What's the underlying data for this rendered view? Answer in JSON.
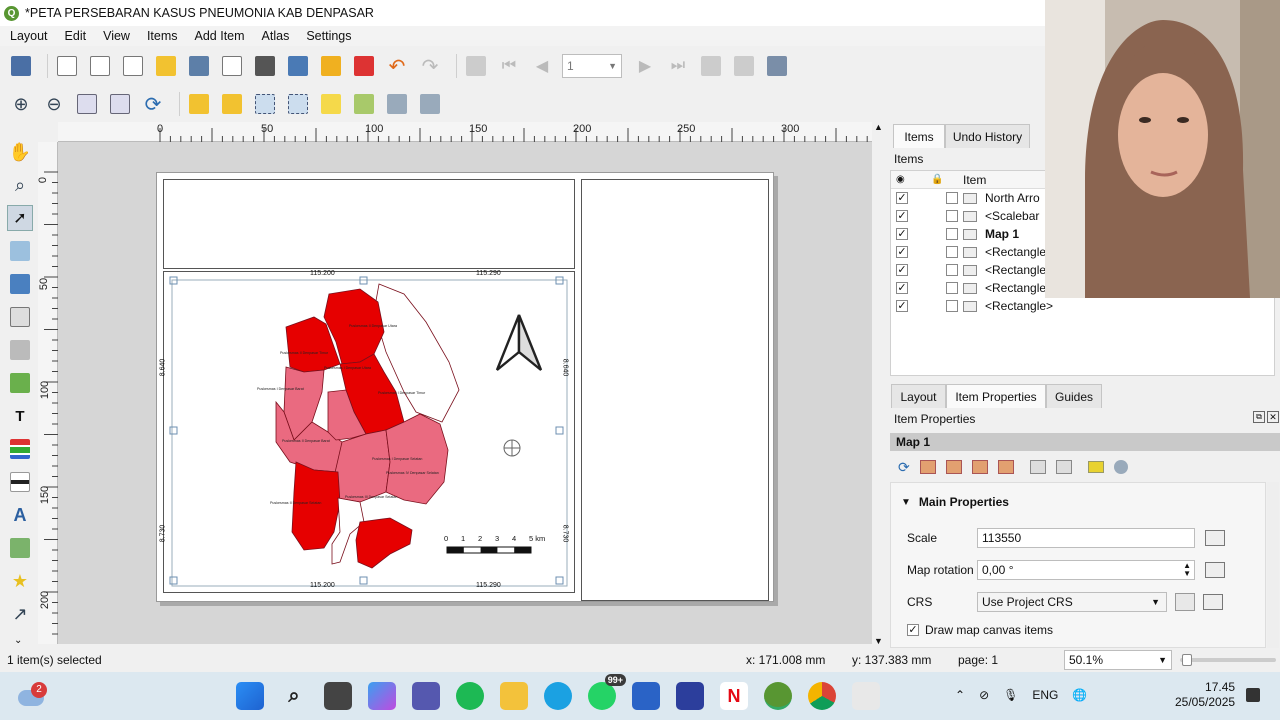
{
  "window": {
    "title": "*PETA PERSEBARAN KASUS PNEUMONIA KAB DENPASAR"
  },
  "menu": [
    "Layout",
    "Edit",
    "View",
    "Items",
    "Add Item",
    "Atlas",
    "Settings"
  ],
  "toolbar1": {
    "page_value": "1",
    "icons": [
      "save-layout-icon",
      "new-layout-icon",
      "duplicate-layout-icon",
      "layout-manager-icon",
      "open-template-icon",
      "save-template-icon",
      "page-setup-icon",
      "print-icon",
      "export-image-icon",
      "export-svg-icon",
      "export-pdf-icon",
      "undo-icon",
      "redo-icon",
      "atlas-settings-icon",
      "first-feature-icon",
      "prev-feature-icon",
      "next-feature-icon",
      "last-feature-icon",
      "atlas-print-icon",
      "atlas-export-icon",
      "atlas-preview-icon"
    ]
  },
  "toolbar2": {
    "icons": [
      "zoom-in-icon",
      "zoom-out-icon",
      "zoom-100-icon",
      "zoom-full-icon",
      "refresh-icon",
      "lock-items-icon",
      "unlock-items-icon",
      "select-all-icon",
      "deselect-icon",
      "raise-items-icon",
      "align-icon",
      "distribute-icon",
      "resize-icon"
    ]
  },
  "left_tools": [
    "pan-icon",
    "zoom-tool-icon",
    "select-move-icon",
    "move-content-icon",
    "edit-nodes-icon",
    "add-map-icon",
    "add-3d-map-icon",
    "add-picture-icon",
    "add-label-icon",
    "add-legend-icon",
    "add-scalebar-icon",
    "add-north-arrow-icon",
    "add-shape-icon",
    "add-marker-icon",
    "add-arrow-icon"
  ],
  "ruler": {
    "h_labels": [
      "0",
      "50",
      "100",
      "150",
      "200",
      "250",
      "300"
    ],
    "v_labels": [
      "0",
      "50",
      "100",
      "150",
      "200"
    ]
  },
  "map": {
    "grid_top": [
      "115.200",
      "115.290"
    ],
    "grid_bottom": [
      "115.200",
      "115.290"
    ],
    "grid_left": [
      "8.640",
      "8.730"
    ],
    "grid_right": [
      "8.640",
      "8.730"
    ],
    "scalebar_labels": [
      "0",
      "1",
      "2",
      "3",
      "4",
      "5 km"
    ],
    "region_labels": [
      "Puskesmas II Denpasar Utara",
      "Puskesmas II Denpasar Timur",
      "Puskesmas I Denpasar Utara",
      "Puskesmas I Denpasar Timur",
      "Puskesmas I Denpasar Barat",
      "Puskesmas II Denpasar Barat",
      "Puskesmas I Denpasar Selatan",
      "Puskesmas IV Denpasar Selatan",
      "Puskesmas III Denpasar Selatan",
      "Puskesmas II Denpasar Selatan"
    ],
    "colors": {
      "dark": "#e60000",
      "light": "#ea6a80",
      "white": "#ffffff"
    }
  },
  "status": {
    "selected": "1 item(s) selected",
    "x": "x: 171.008 mm",
    "y": "y: 137.383 mm",
    "page": "page: 1",
    "zoom": "50.1%"
  },
  "panel": {
    "tabs_top": [
      "Items",
      "Undo History"
    ],
    "items_label": "Items",
    "tree_header": "Item",
    "tree_rows": [
      {
        "name": "North Arro",
        "icon": "picture-icon",
        "bold": false
      },
      {
        "name": "<Scalebar",
        "icon": "scalebar-icon",
        "bold": false
      },
      {
        "name": "Map 1",
        "icon": "map-icon",
        "bold": true
      },
      {
        "name": "<Rectangle",
        "icon": "rectangle-icon",
        "bold": false
      },
      {
        "name": "<Rectangle",
        "icon": "rectangle-icon",
        "bold": false
      },
      {
        "name": "<Rectangle",
        "icon": "rectangle-icon",
        "bold": false
      },
      {
        "name": "<Rectangle>",
        "icon": "rectangle-icon",
        "bold": false
      }
    ],
    "tabs_bottom": [
      "Layout",
      "Item Properties",
      "Guides"
    ],
    "item_properties_title": "Item Properties",
    "section_title": "Map 1",
    "main_properties": "Main Properties",
    "scale_label": "Scale",
    "scale_value": "113550",
    "rotation_label": "Map rotation",
    "rotation_value": "0,00 °",
    "crs_label": "CRS",
    "crs_value": "Use Project CRS",
    "draw_canvas_items": "Draw map canvas items"
  },
  "taskbar": {
    "weather_badge": "2",
    "whatsapp_badge": "99+",
    "lang": "ENG",
    "time": "17.45",
    "date": "25/05/2025"
  }
}
